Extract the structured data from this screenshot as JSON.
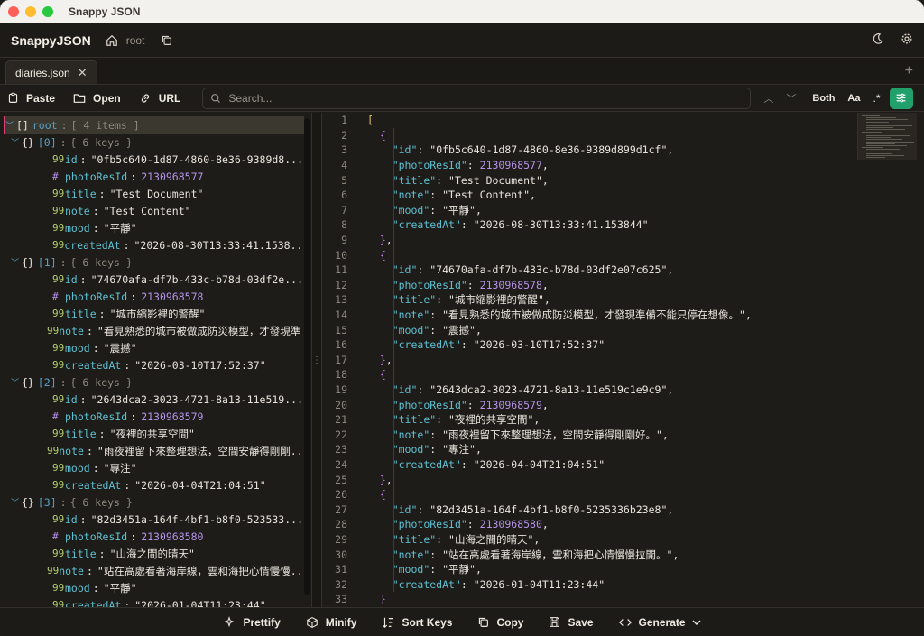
{
  "window": {
    "title": "Snappy JSON"
  },
  "header": {
    "brand": "SnappyJSON",
    "crumb": "root"
  },
  "tabs": [
    {
      "label": "diaries.json"
    }
  ],
  "toolbar": {
    "paste": "Paste",
    "open": "Open",
    "url": "URL",
    "search_placeholder": "Search...",
    "both": "Both",
    "aa": "Aa",
    "regex": ".*"
  },
  "tree": {
    "root_label": "root",
    "root_meta": "[ 4 items ]",
    "items": [
      {
        "index": "[0]",
        "meta": "{ 6 keys }",
        "id": "\"0fb5c640-1d87-4860-8e36-9389d8...",
        "photoResId": "2130968577",
        "title": "\"Test Document\"",
        "note": "\"Test Content\"",
        "mood": "\"平靜\"",
        "createdAt": "\"2026-08-30T13:33:41.1538..."
      },
      {
        "index": "[1]",
        "meta": "{ 6 keys }",
        "id": "\"74670afa-df7b-433c-b78d-03df2e...",
        "photoResId": "2130968578",
        "title": "\"城市縮影裡的警醒\"",
        "note": "\"看見熟悉的城市被做成防災模型，才發現準...",
        "mood": "\"震撼\"",
        "createdAt": "\"2026-03-10T17:52:37\""
      },
      {
        "index": "[2]",
        "meta": "{ 6 keys }",
        "id": "\"2643dca2-3023-4721-8a13-11e519...",
        "photoResId": "2130968579",
        "title": "\"夜裡的共享空間\"",
        "note": "\"雨夜裡留下來整理想法，空間安靜得剛剛...",
        "mood": "\"專注\"",
        "createdAt": "\"2026-04-04T21:04:51\""
      },
      {
        "index": "[3]",
        "meta": "{ 6 keys }",
        "id": "\"82d3451a-164f-4bf1-b8f0-523533...",
        "photoResId": "2130968580",
        "title": "\"山海之間的晴天\"",
        "note": "\"站在高處看著海岸線，雲和海把心情慢慢...",
        "mood": "\"平靜\"",
        "createdAt": "\"2026-01-04T11:23:44\""
      }
    ]
  },
  "code": {
    "records": [
      {
        "id": "0fb5c640-1d87-4860-8e36-9389d899d1cf",
        "photoResId": "2130968577",
        "title": "Test Document",
        "note": "Test Content",
        "mood": "平靜",
        "createdAt": "2026-08-30T13:33:41.153844"
      },
      {
        "id": "74670afa-df7b-433c-b78d-03df2e07c625",
        "photoResId": "2130968578",
        "title": "城市縮影裡的警醒",
        "note": "看見熟悉的城市被做成防災模型，才發現準備不能只停在想像。",
        "mood": "震撼",
        "createdAt": "2026-03-10T17:52:37"
      },
      {
        "id": "2643dca2-3023-4721-8a13-11e519c1e9c9",
        "photoResId": "2130968579",
        "title": "夜裡的共享空間",
        "note": "雨夜裡留下來整理想法，空間安靜得剛剛好。",
        "mood": "專注",
        "createdAt": "2026-04-04T21:04:51"
      },
      {
        "id": "82d3451a-164f-4bf1-b8f0-5235336b23e8",
        "photoResId": "2130968580",
        "title": "山海之間的晴天",
        "note": "站在高處看著海岸線，雲和海把心情慢慢拉開。",
        "mood": "平靜",
        "createdAt": "2026-01-04T11:23:44"
      }
    ]
  },
  "bottom": {
    "prettify": "Prettify",
    "minify": "Minify",
    "sort_keys": "Sort Keys",
    "copy": "Copy",
    "save": "Save",
    "generate": "Generate"
  },
  "colors": {
    "accent": "#22a06b",
    "key": "#5ec0d2",
    "number": "#b692e8",
    "bracket": "#e0c35a",
    "brace": "#c079e0"
  }
}
